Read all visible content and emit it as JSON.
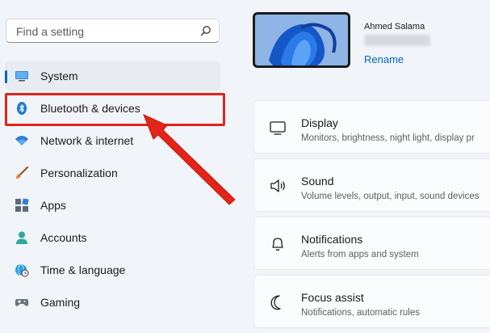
{
  "search": {
    "placeholder": "Find a setting",
    "icon": "search-icon"
  },
  "nav": {
    "items": [
      {
        "label": "System",
        "icon": "monitor-icon",
        "selected": true
      },
      {
        "label": "Bluetooth & devices",
        "icon": "bluetooth-icon",
        "selected": false
      },
      {
        "label": "Network & internet",
        "icon": "wifi-icon",
        "selected": false
      },
      {
        "label": "Personalization",
        "icon": "brush-icon",
        "selected": false
      },
      {
        "label": "Apps",
        "icon": "apps-icon",
        "selected": false
      },
      {
        "label": "Accounts",
        "icon": "person-icon",
        "selected": false
      },
      {
        "label": "Time & language",
        "icon": "globe-clock-icon",
        "selected": false
      },
      {
        "label": "Gaming",
        "icon": "gamepad-icon",
        "selected": false
      }
    ]
  },
  "profile": {
    "name": "Ahmed Salama",
    "rename_label": "Rename"
  },
  "cards": [
    {
      "title": "Display",
      "desc": "Monitors, brightness, night light, display pr",
      "icon": "display-icon"
    },
    {
      "title": "Sound",
      "desc": "Volume levels, output, input, sound devices",
      "icon": "speaker-icon"
    },
    {
      "title": "Notifications",
      "desc": "Alerts from apps and system",
      "icon": "bell-icon"
    },
    {
      "title": "Focus assist",
      "desc": "Notifications, automatic rules",
      "icon": "moon-icon"
    }
  ],
  "colors": {
    "accent": "#0067c0",
    "annotation": "#e2241a",
    "background": "#f1f4f9"
  }
}
